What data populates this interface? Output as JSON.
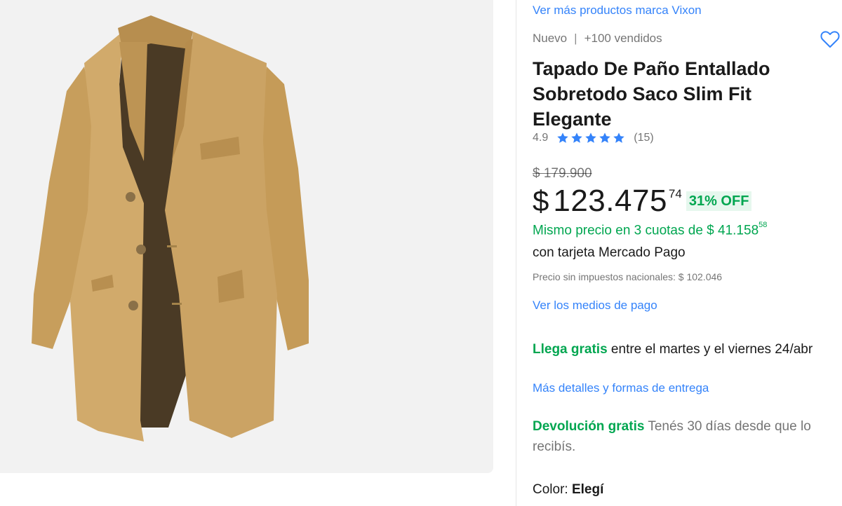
{
  "brand_link": "Ver más productos marca Vixon",
  "meta": {
    "condition": "Nuevo",
    "separator": "|",
    "sold": "+100 vendidos"
  },
  "favorite_icon": "heart-outline-icon",
  "title": "Tapado De Paño Entallado Sobretodo Saco Slim Fit Elegante",
  "rating": {
    "score": "4.9",
    "stars": 5,
    "count": "(15)",
    "star_color": "#3483fa"
  },
  "price": {
    "original": "$ 179.900",
    "symbol": "$",
    "main": "123.475",
    "cents": "74",
    "discount": "31% OFF"
  },
  "installments": {
    "text": "Mismo precio en 3 cuotas de $ 41.158",
    "cents": "58",
    "subtext": "con tarjeta Mercado Pago"
  },
  "tax_note": "Precio sin impuestos nacionales: $ 102.046",
  "payment_link": "Ver los medios de pago",
  "shipping": {
    "highlight": "Llega gratis",
    "text": " entre el martes y el viernes 24/abr",
    "link": "Más detalles y formas de entrega"
  },
  "returns": {
    "highlight": "Devolución gratis",
    "text": " Tenés 30 días desde que lo recibís."
  },
  "color": {
    "label": "Color: ",
    "value": "Elegí"
  },
  "colors": {
    "link": "#3483fa",
    "green": "#00a650",
    "coat": "#c9a264"
  }
}
